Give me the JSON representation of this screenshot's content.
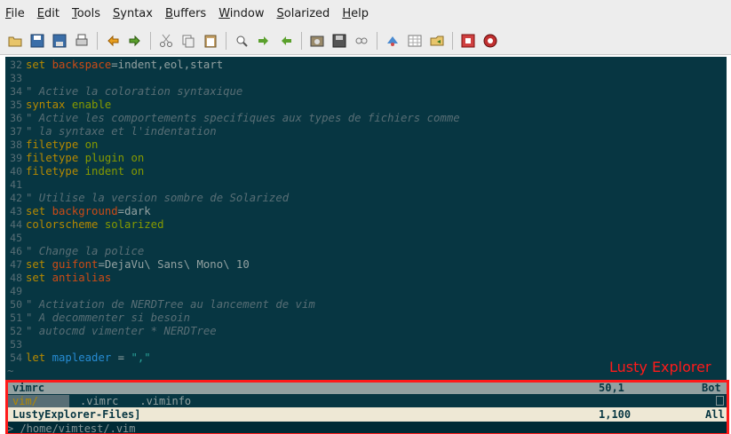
{
  "menu": [
    {
      "label": "File",
      "u": "F",
      "rest": "ile"
    },
    {
      "label": "Edit",
      "u": "E",
      "rest": "dit"
    },
    {
      "label": "Tools",
      "u": "T",
      "rest": "ools"
    },
    {
      "label": "Syntax",
      "u": "S",
      "rest": "yntax"
    },
    {
      "label": "Buffers",
      "u": "B",
      "rest": "uffers"
    },
    {
      "label": "Window",
      "u": "W",
      "rest": "indow"
    },
    {
      "label": "Solarized",
      "u": "S",
      "rest": "olarized"
    },
    {
      "label": "Help",
      "u": "H",
      "rest": "elp"
    }
  ],
  "toolbar": {
    "icons": [
      "open-icon",
      "save-icon",
      "save-all-icon",
      "print-icon",
      "sep",
      "undo-icon",
      "redo-icon",
      "sep",
      "cut-icon",
      "copy-icon",
      "paste-icon",
      "sep",
      "find-replace-icon",
      "find-next-icon",
      "find-prev-icon",
      "sep",
      "load-session-icon",
      "save-session-icon",
      "run-script-icon",
      "sep",
      "make-icon",
      "shell-icon",
      "ctags-icon",
      "sep",
      "help-icon",
      "find-help-icon"
    ]
  },
  "editor": {
    "lines": [
      {
        "n": "32",
        "segs": [
          [
            "kw-o",
            "set "
          ],
          [
            "opt",
            "backspace"
          ],
          [
            "val",
            "=indent,eol,start"
          ]
        ]
      },
      {
        "n": "33",
        "segs": []
      },
      {
        "n": "34",
        "segs": [
          [
            "cm",
            "\" Active la coloration syntaxique"
          ]
        ]
      },
      {
        "n": "35",
        "segs": [
          [
            "kw-o",
            "syntax "
          ],
          [
            "kw",
            "enable"
          ]
        ]
      },
      {
        "n": "36",
        "segs": [
          [
            "cm",
            "\" Active les comportements specifiques aux types de fichiers comme"
          ]
        ]
      },
      {
        "n": "37",
        "segs": [
          [
            "cm",
            "\" la syntaxe et l'indentation"
          ]
        ]
      },
      {
        "n": "38",
        "segs": [
          [
            "kw-o",
            "filetype "
          ],
          [
            "kw",
            "on"
          ]
        ]
      },
      {
        "n": "39",
        "segs": [
          [
            "kw-o",
            "filetype "
          ],
          [
            "kw",
            "plugin on"
          ]
        ]
      },
      {
        "n": "40",
        "segs": [
          [
            "kw-o",
            "filetype "
          ],
          [
            "kw",
            "indent on"
          ]
        ]
      },
      {
        "n": "41",
        "segs": []
      },
      {
        "n": "42",
        "segs": [
          [
            "cm",
            "\" Utilise la version sombre de Solarized"
          ]
        ]
      },
      {
        "n": "43",
        "segs": [
          [
            "kw-o",
            "set "
          ],
          [
            "opt",
            "background"
          ],
          [
            "val",
            "=dark"
          ]
        ]
      },
      {
        "n": "44",
        "segs": [
          [
            "kw-o",
            "colorscheme "
          ],
          [
            "kw",
            "solarized"
          ]
        ]
      },
      {
        "n": "45",
        "segs": []
      },
      {
        "n": "46",
        "segs": [
          [
            "cm",
            "\" Change la police"
          ]
        ]
      },
      {
        "n": "47",
        "segs": [
          [
            "kw-o",
            "set "
          ],
          [
            "opt",
            "guifont"
          ],
          [
            "val",
            "=DejaVu\\ Sans\\ Mono\\ 10"
          ]
        ]
      },
      {
        "n": "48",
        "segs": [
          [
            "kw-o",
            "set "
          ],
          [
            "opt",
            "antialias"
          ]
        ]
      },
      {
        "n": "49",
        "segs": []
      },
      {
        "n": "50",
        "segs": [
          [
            "cm",
            "\" Activation de NERDTree au lancement de vim"
          ]
        ]
      },
      {
        "n": "51",
        "segs": [
          [
            "cm",
            "\" A decommenter si besoin"
          ]
        ]
      },
      {
        "n": "52",
        "segs": [
          [
            "cm",
            "\" autocmd vimenter * NERDTree"
          ]
        ]
      },
      {
        "n": "53",
        "segs": []
      },
      {
        "n": "54",
        "segs": [
          [
            "kw-o",
            "let "
          ],
          [
            "opt-b",
            "mapleader"
          ],
          [
            "val",
            " = "
          ],
          [
            "str",
            "\",\""
          ]
        ]
      },
      {
        "n": "~",
        "segs": []
      }
    ]
  },
  "lusty_label": "Lusty Explorer",
  "status1": {
    "name": "vimrc",
    "pos": "50,1",
    "scroll": "Bot"
  },
  "files": {
    "dir": "vim/",
    "items": [
      ".vimrc",
      ".viminfo"
    ]
  },
  "status2": {
    "name": "LustyExplorer-Files]",
    "pos": "1,100",
    "scroll": "All"
  },
  "prompt": {
    "text": "> /home/vimtest/.vim"
  },
  "colors": {
    "bg": "#073642",
    "frame": "#ff1a1a"
  }
}
